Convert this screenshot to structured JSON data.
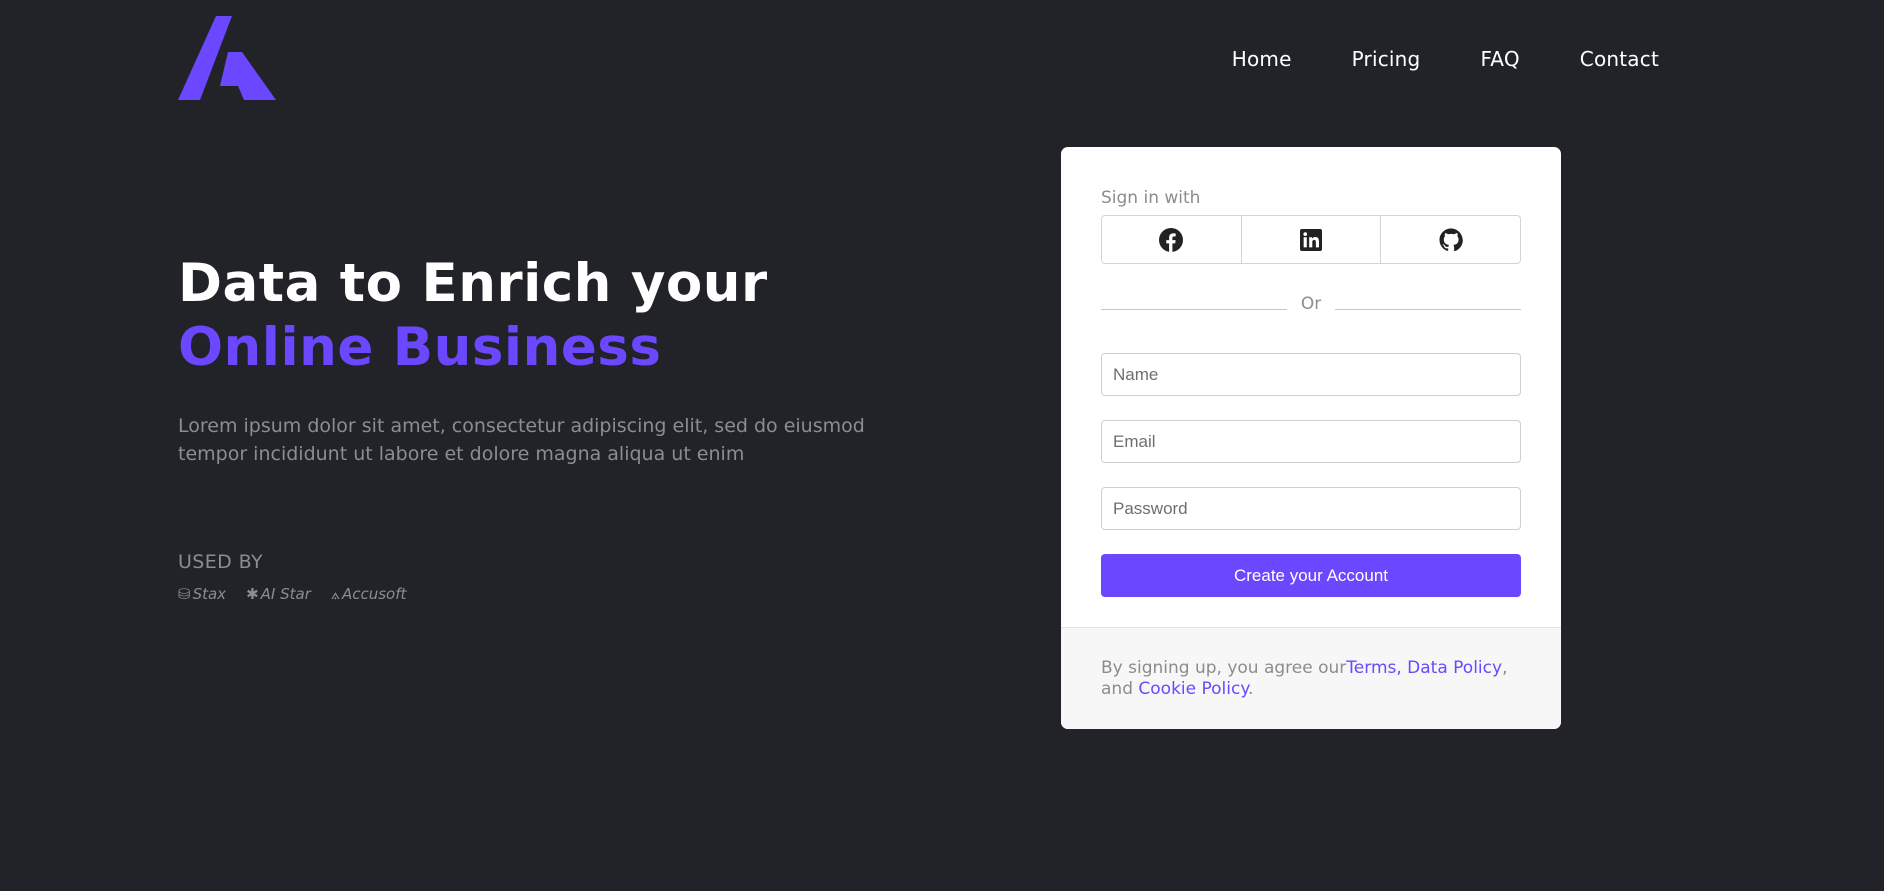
{
  "nav": {
    "items": [
      "Home",
      "Pricing",
      "FAQ",
      "Contact"
    ]
  },
  "hero": {
    "title_line1": "Data to Enrich your",
    "title_line2": "Online Business",
    "description": "Lorem ipsum dolor sit amet, consectetur adipiscing elit, sed do eiusmod tempor incididunt ut labore et dolore magna aliqua ut enim"
  },
  "used_by": {
    "label": "USED BY",
    "brands": [
      {
        "name": "Stax",
        "icon": "database-icon"
      },
      {
        "name": "AI Star",
        "icon": "asterisk-icon"
      },
      {
        "name": "Accusoft",
        "icon": "accusoft-icon"
      }
    ]
  },
  "form": {
    "sign_in_with": "Sign in with",
    "social": [
      "facebook-icon",
      "linkedin-icon",
      "github-icon"
    ],
    "or": "Or",
    "name_placeholder": "Name",
    "email_placeholder": "Email",
    "password_placeholder": "Password",
    "submit_label": "Create your Account",
    "footer_prefix": "By signing up, you agree our",
    "terms_link": "Terms, Data Policy",
    "footer_and": ", and ",
    "cookie_link": "Cookie Policy",
    "footer_suffix": "."
  },
  "colors": {
    "background": "#212328",
    "accent": "#6b48ff",
    "muted_text": "#8b8d92"
  }
}
